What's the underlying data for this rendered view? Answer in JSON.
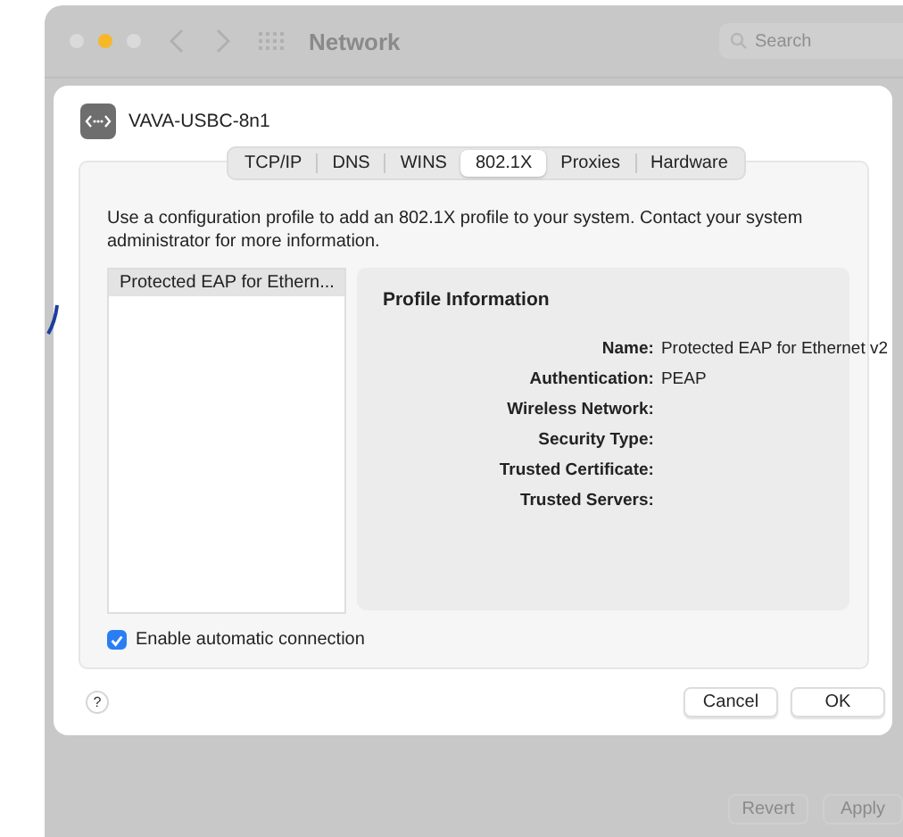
{
  "window": {
    "title": "Network",
    "search": {
      "placeholder": "Search"
    }
  },
  "sheet": {
    "interface_name": "VAVA-USBC-8n1",
    "tabs": [
      {
        "label": "TCP/IP",
        "selected": false
      },
      {
        "label": "DNS",
        "selected": false
      },
      {
        "label": "WINS",
        "selected": false
      },
      {
        "label": "802.1X",
        "selected": true
      },
      {
        "label": "Proxies",
        "selected": false
      },
      {
        "label": "Hardware",
        "selected": false
      }
    ],
    "description": "Use a configuration profile to add an 802.1X profile to your system. Contact your system administrator for more information.",
    "profiles": [
      {
        "label": "Protected EAP for Ethern...",
        "selected": true
      }
    ],
    "profile_information": {
      "title": "Profile Information",
      "fields": [
        {
          "label": "Name:",
          "value": "Protected EAP for Ethernet v2"
        },
        {
          "label": "Authentication:",
          "value": "PEAP"
        },
        {
          "label": "Wireless Network:"
        },
        {
          "label": "Security Type:"
        },
        {
          "label": "Trusted Certificate:"
        },
        {
          "label": "Trusted Servers:"
        }
      ]
    },
    "auto_connect": {
      "label": "Enable automatic connection",
      "checked": true
    },
    "help": "?",
    "buttons": [
      "Cancel",
      "OK"
    ]
  },
  "footer_buttons": [
    {
      "label": "Revert",
      "disabled": true
    },
    {
      "label": "Apply",
      "disabled": true
    }
  ]
}
